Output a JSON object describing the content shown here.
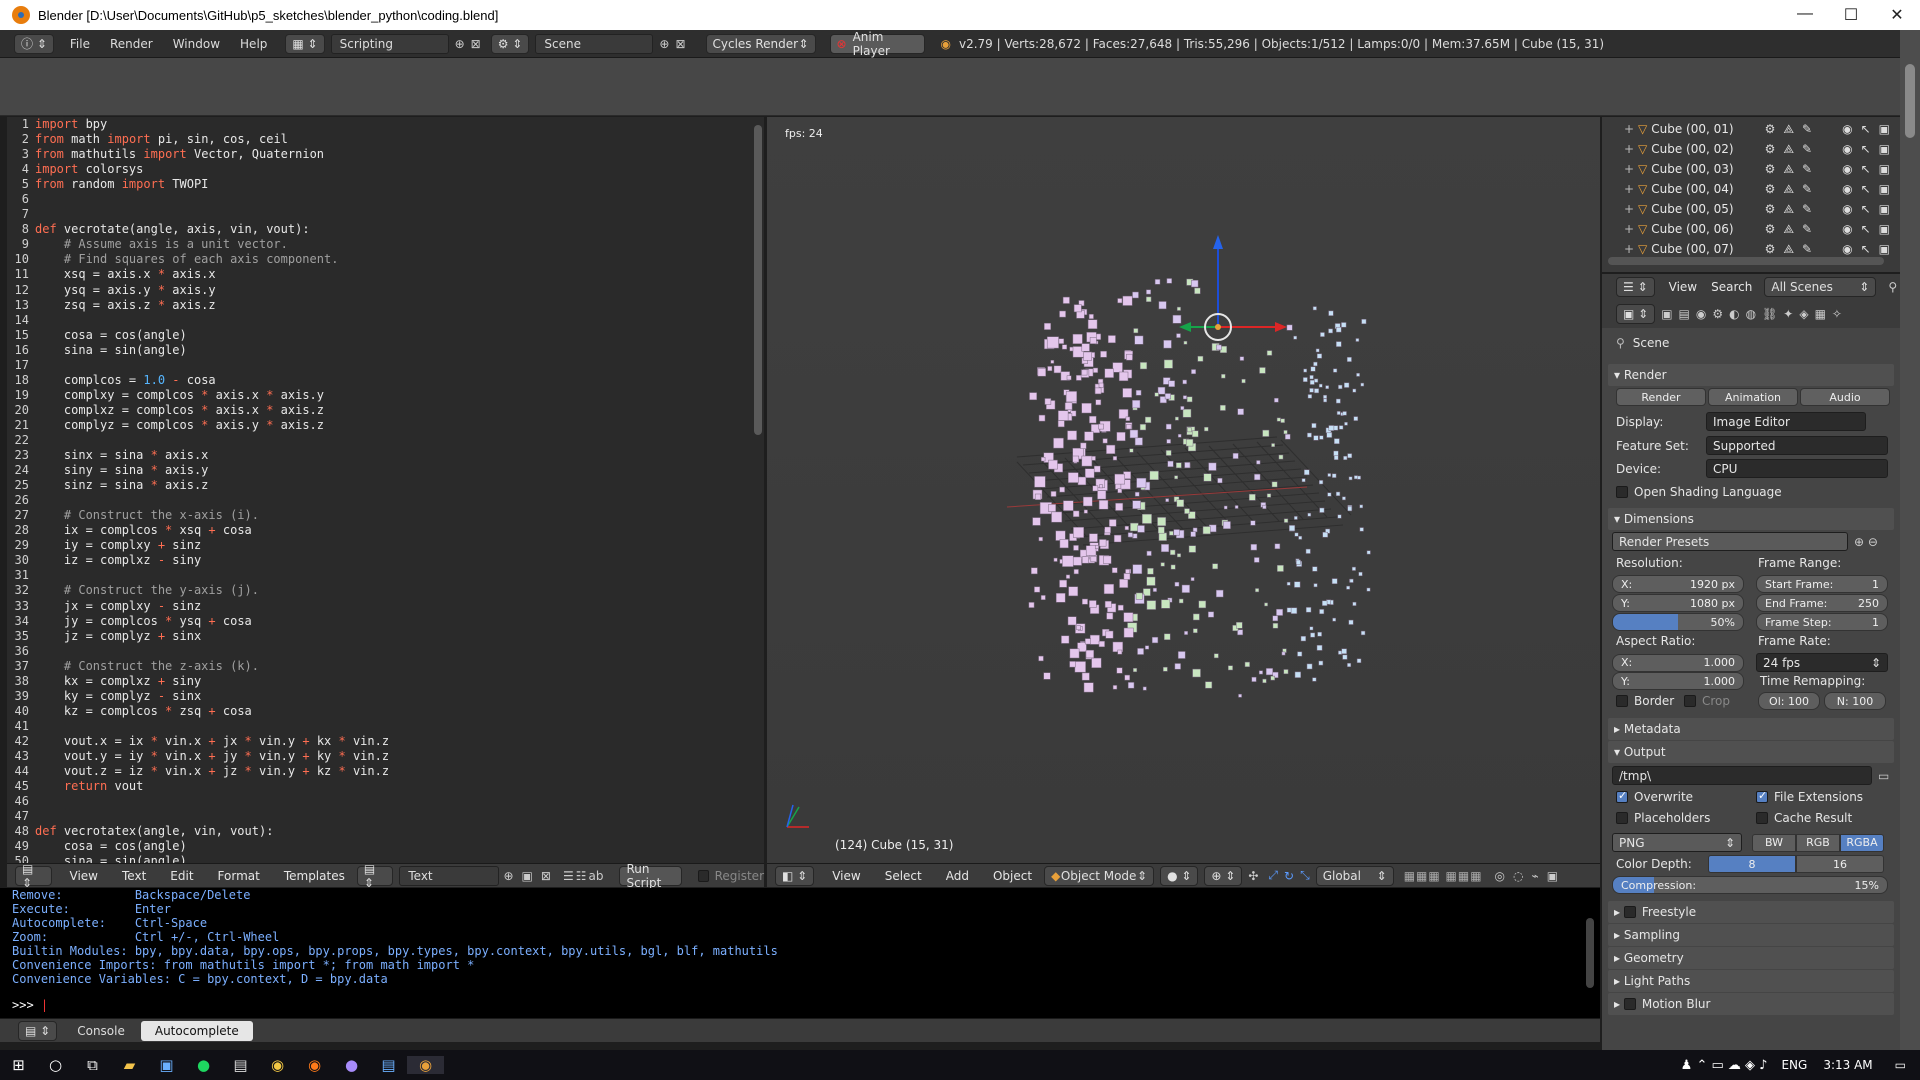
{
  "window": {
    "title": "Blender [D:\\User\\Documents\\GitHub\\p5_sketches\\blender_python\\coding.blend]",
    "controls": [
      "—",
      "☐",
      "✕"
    ]
  },
  "info": {
    "menus": [
      "File",
      "Render",
      "Window",
      "Help"
    ],
    "layout": "Scripting",
    "scene": "Scene",
    "engine": "Cycles Render",
    "anim_player": "Anim Player",
    "stats": "v2.79 | Verts:28,672 | Faces:27,648 | Tris:55,296 | Objects:1/512 | Lamps:0/0 | Mem:37.65M | Cube (15, 31)"
  },
  "code": [
    {
      "n": "1",
      "t": [
        [
          "kw",
          "import"
        ],
        [
          "tx",
          " bpy"
        ]
      ]
    },
    {
      "n": "2",
      "t": [
        [
          "kw",
          "from"
        ],
        [
          "tx",
          " math "
        ],
        [
          "kw",
          "import"
        ],
        [
          "tx",
          " pi, sin, cos, ceil"
        ]
      ]
    },
    {
      "n": "3",
      "t": [
        [
          "kw",
          "from"
        ],
        [
          "tx",
          " mathutils "
        ],
        [
          "kw",
          "import"
        ],
        [
          "tx",
          " Vector, Quaternion"
        ]
      ]
    },
    {
      "n": "4",
      "t": [
        [
          "kw",
          "import"
        ],
        [
          "tx",
          " colorsys"
        ]
      ]
    },
    {
      "n": "5",
      "t": [
        [
          "kw",
          "from"
        ],
        [
          "tx",
          " random "
        ],
        [
          "kw",
          "import"
        ],
        [
          "tx",
          " TWOPI"
        ]
      ]
    },
    {
      "n": "6",
      "t": []
    },
    {
      "n": "7",
      "t": []
    },
    {
      "n": "8",
      "t": [
        [
          "kw",
          "def"
        ],
        [
          "tx",
          " vecrotate(angle, axis, vin, vout):"
        ]
      ]
    },
    {
      "n": "9",
      "t": [
        [
          "cm",
          "    # Assume axis is a unit vector."
        ]
      ]
    },
    {
      "n": "10",
      "t": [
        [
          "cm",
          "    # Find squares of each axis component."
        ]
      ]
    },
    {
      "n": "11",
      "t": [
        [
          "tx",
          "    xsq = axis.x "
        ],
        [
          "op",
          "*"
        ],
        [
          "tx",
          " axis.x"
        ]
      ]
    },
    {
      "n": "12",
      "t": [
        [
          "tx",
          "    ysq = axis.y "
        ],
        [
          "op",
          "*"
        ],
        [
          "tx",
          " axis.y"
        ]
      ]
    },
    {
      "n": "13",
      "t": [
        [
          "tx",
          "    zsq = axis.z "
        ],
        [
          "op",
          "*"
        ],
        [
          "tx",
          " axis.z"
        ]
      ]
    },
    {
      "n": "14",
      "t": []
    },
    {
      "n": "15",
      "t": [
        [
          "tx",
          "    cosa = cos(angle)"
        ]
      ]
    },
    {
      "n": "16",
      "t": [
        [
          "tx",
          "    sina = sin(angle)"
        ]
      ]
    },
    {
      "n": "17",
      "t": []
    },
    {
      "n": "18",
      "t": [
        [
          "tx",
          "    complcos = "
        ],
        [
          "nm",
          "1.0"
        ],
        [
          "tx",
          " "
        ],
        [
          "op",
          "-"
        ],
        [
          "tx",
          " cosa"
        ]
      ]
    },
    {
      "n": "19",
      "t": [
        [
          "tx",
          "    complxy = complcos "
        ],
        [
          "op",
          "*"
        ],
        [
          "tx",
          " axis.x "
        ],
        [
          "op",
          "*"
        ],
        [
          "tx",
          " axis.y"
        ]
      ]
    },
    {
      "n": "20",
      "t": [
        [
          "tx",
          "    complxz = complcos "
        ],
        [
          "op",
          "*"
        ],
        [
          "tx",
          " axis.x "
        ],
        [
          "op",
          "*"
        ],
        [
          "tx",
          " axis.z"
        ]
      ]
    },
    {
      "n": "21",
      "t": [
        [
          "tx",
          "    complyz = complcos "
        ],
        [
          "op",
          "*"
        ],
        [
          "tx",
          " axis.y "
        ],
        [
          "op",
          "*"
        ],
        [
          "tx",
          " axis.z"
        ]
      ]
    },
    {
      "n": "22",
      "t": []
    },
    {
      "n": "23",
      "t": [
        [
          "tx",
          "    sinx = sina "
        ],
        [
          "op",
          "*"
        ],
        [
          "tx",
          " axis.x"
        ]
      ]
    },
    {
      "n": "24",
      "t": [
        [
          "tx",
          "    siny = sina "
        ],
        [
          "op",
          "*"
        ],
        [
          "tx",
          " axis.y"
        ]
      ]
    },
    {
      "n": "25",
      "t": [
        [
          "tx",
          "    sinz = sina "
        ],
        [
          "op",
          "*"
        ],
        [
          "tx",
          " axis.z"
        ]
      ]
    },
    {
      "n": "26",
      "t": []
    },
    {
      "n": "27",
      "t": [
        [
          "cm",
          "    # Construct the x-axis (i)."
        ]
      ]
    },
    {
      "n": "28",
      "t": [
        [
          "tx",
          "    ix = complcos "
        ],
        [
          "op",
          "*"
        ],
        [
          "tx",
          " xsq "
        ],
        [
          "op",
          "+"
        ],
        [
          "tx",
          " cosa"
        ]
      ]
    },
    {
      "n": "29",
      "t": [
        [
          "tx",
          "    iy = complxy "
        ],
        [
          "op",
          "+"
        ],
        [
          "tx",
          " sinz"
        ]
      ]
    },
    {
      "n": "30",
      "t": [
        [
          "tx",
          "    iz = complxz "
        ],
        [
          "op",
          "-"
        ],
        [
          "tx",
          " siny"
        ]
      ]
    },
    {
      "n": "31",
      "t": []
    },
    {
      "n": "32",
      "t": [
        [
          "cm",
          "    # Construct the y-axis (j)."
        ]
      ]
    },
    {
      "n": "33",
      "t": [
        [
          "tx",
          "    jx = complxy "
        ],
        [
          "op",
          "-"
        ],
        [
          "tx",
          " sinz"
        ]
      ]
    },
    {
      "n": "34",
      "t": [
        [
          "tx",
          "    jy = complcos "
        ],
        [
          "op",
          "*"
        ],
        [
          "tx",
          " ysq "
        ],
        [
          "op",
          "+"
        ],
        [
          "tx",
          " cosa"
        ]
      ]
    },
    {
      "n": "35",
      "t": [
        [
          "tx",
          "    jz = complyz "
        ],
        [
          "op",
          "+"
        ],
        [
          "tx",
          " sinx"
        ]
      ]
    },
    {
      "n": "36",
      "t": []
    },
    {
      "n": "37",
      "t": [
        [
          "cm",
          "    # Construct the z-axis (k)."
        ]
      ]
    },
    {
      "n": "38",
      "t": [
        [
          "tx",
          "    kx = complxz "
        ],
        [
          "op",
          "+"
        ],
        [
          "tx",
          " siny"
        ]
      ]
    },
    {
      "n": "39",
      "t": [
        [
          "tx",
          "    ky = complyz "
        ],
        [
          "op",
          "-"
        ],
        [
          "tx",
          " sinx"
        ]
      ]
    },
    {
      "n": "40",
      "t": [
        [
          "tx",
          "    kz = complcos "
        ],
        [
          "op",
          "*"
        ],
        [
          "tx",
          " zsq "
        ],
        [
          "op",
          "+"
        ],
        [
          "tx",
          " cosa"
        ]
      ]
    },
    {
      "n": "41",
      "t": []
    },
    {
      "n": "42",
      "t": [
        [
          "tx",
          "    vout.x = ix "
        ],
        [
          "op",
          "*"
        ],
        [
          "tx",
          " vin.x "
        ],
        [
          "op",
          "+"
        ],
        [
          "tx",
          " jx "
        ],
        [
          "op",
          "*"
        ],
        [
          "tx",
          " vin.y "
        ],
        [
          "op",
          "+"
        ],
        [
          "tx",
          " kx "
        ],
        [
          "op",
          "*"
        ],
        [
          "tx",
          " vin.z"
        ]
      ]
    },
    {
      "n": "43",
      "t": [
        [
          "tx",
          "    vout.y = iy "
        ],
        [
          "op",
          "*"
        ],
        [
          "tx",
          " vin.x "
        ],
        [
          "op",
          "+"
        ],
        [
          "tx",
          " jy "
        ],
        [
          "op",
          "*"
        ],
        [
          "tx",
          " vin.y "
        ],
        [
          "op",
          "+"
        ],
        [
          "tx",
          " ky "
        ],
        [
          "op",
          "*"
        ],
        [
          "tx",
          " vin.z"
        ]
      ]
    },
    {
      "n": "44",
      "t": [
        [
          "tx",
          "    vout.z = iz "
        ],
        [
          "op",
          "*"
        ],
        [
          "tx",
          " vin.x "
        ],
        [
          "op",
          "+"
        ],
        [
          "tx",
          " jz "
        ],
        [
          "op",
          "*"
        ],
        [
          "tx",
          " vin.y "
        ],
        [
          "op",
          "+"
        ],
        [
          "tx",
          " kz "
        ],
        [
          "op",
          "*"
        ],
        [
          "tx",
          " vin.z"
        ]
      ]
    },
    {
      "n": "45",
      "t": [
        [
          "kw",
          "    return"
        ],
        [
          "tx",
          " vout"
        ]
      ]
    },
    {
      "n": "46",
      "t": []
    },
    {
      "n": "47",
      "t": []
    },
    {
      "n": "48",
      "t": [
        [
          "kw",
          "def"
        ],
        [
          "tx",
          " vecrotatex(angle, vin, vout):"
        ]
      ]
    },
    {
      "n": "49",
      "t": [
        [
          "tx",
          "    cosa = cos(angle)"
        ]
      ]
    },
    {
      "n": "50",
      "t": [
        [
          "tx",
          "    sina = sin(angle)"
        ]
      ]
    }
  ],
  "text_editor": {
    "menus": [
      "View",
      "Text",
      "Edit",
      "Format",
      "Templates"
    ],
    "datablock": "Text",
    "run_script": "Run Script",
    "register": "Register"
  },
  "viewport": {
    "fps": "fps: 24",
    "object_label": "(124) Cube (15, 31)",
    "menus": [
      "View",
      "Select",
      "Add",
      "Object"
    ],
    "mode": "Object Mode",
    "orientation": "Global"
  },
  "console": {
    "lines": [
      "Remove:          Backspace/Delete",
      "Execute:         Enter",
      "Autocomplete:    Ctrl-Space",
      "Zoom:            Ctrl +/-, Ctrl-Wheel",
      "Builtin Modules: bpy, bpy.data, bpy.ops, bpy.props, bpy.types, bpy.context, bpy.utils, bgl, blf, mathutils",
      "Convenience Imports: from mathutils import *; from math import *",
      "Convenience Variables: C = bpy.context, D = bpy.data"
    ],
    "prompt": ">>> ",
    "tabs": [
      "Console",
      "Autocomplete"
    ]
  },
  "outliner": {
    "items": [
      "Cube (00, 01)",
      "Cube (00, 02)",
      "Cube (00, 03)",
      "Cube (00, 04)",
      "Cube (00, 05)",
      "Cube (00, 06)",
      "Cube (00, 07)"
    ],
    "menus": [
      "View",
      "Search"
    ],
    "scope": "All Scenes"
  },
  "properties": {
    "scene": "Scene",
    "render": {
      "title": "Render",
      "buttons": [
        "Render",
        "Animation",
        "Audio"
      ],
      "display_label": "Display:",
      "display_value": "Image Editor",
      "feature_label": "Feature Set:",
      "feature_value": "Supported",
      "device_label": "Device:",
      "device_value": "CPU",
      "osl": "Open Shading Language"
    },
    "dimensions": {
      "title": "Dimensions",
      "presets": "Render Presets",
      "resolution": "Resolution:",
      "res_x": "1920 px",
      "res_y": "1080 px",
      "res_pct": "50%",
      "res_pct_value": 0.5,
      "frame_range": "Frame Range:",
      "start": "Start Frame:",
      "start_v": "1",
      "end": "End Frame:",
      "end_v": "250",
      "step": "Frame Step:",
      "step_v": "1",
      "aspect": "Aspect Ratio:",
      "ax": "1.000",
      "ay": "1.000",
      "frame_rate": "Frame Rate:",
      "fps": "24 fps",
      "time_remap": "Time Remapping:",
      "old": "Ol: 100",
      "new": "N: 100",
      "border": "Border",
      "crop": "Crop"
    },
    "metadata": "Metadata",
    "output": {
      "title": "Output",
      "path": "/tmp\\",
      "overwrite": "Overwrite",
      "file_ext": "File Extensions",
      "placeholders": "Placeholders",
      "cache": "Cache Result",
      "format": "PNG",
      "modes": [
        "BW",
        "RGB",
        "RGBA"
      ],
      "depth_label": "Color Depth:",
      "depth_8": "8",
      "depth_16": "16",
      "compression": "Compression:",
      "compression_v": "15%",
      "compression_value": 0.15
    },
    "collapsed": [
      "Freestyle",
      "Sampling",
      "Geometry",
      "Light Paths",
      "Motion Blur"
    ]
  },
  "taskbar": {
    "lang": "ENG",
    "time": "3:13 AM"
  },
  "colors": {
    "keyword": "#ff6e52",
    "comment": "#a0a0a0",
    "number": "#56b6ff",
    "console_text": "#7bafff",
    "accent": "#5680c2"
  }
}
